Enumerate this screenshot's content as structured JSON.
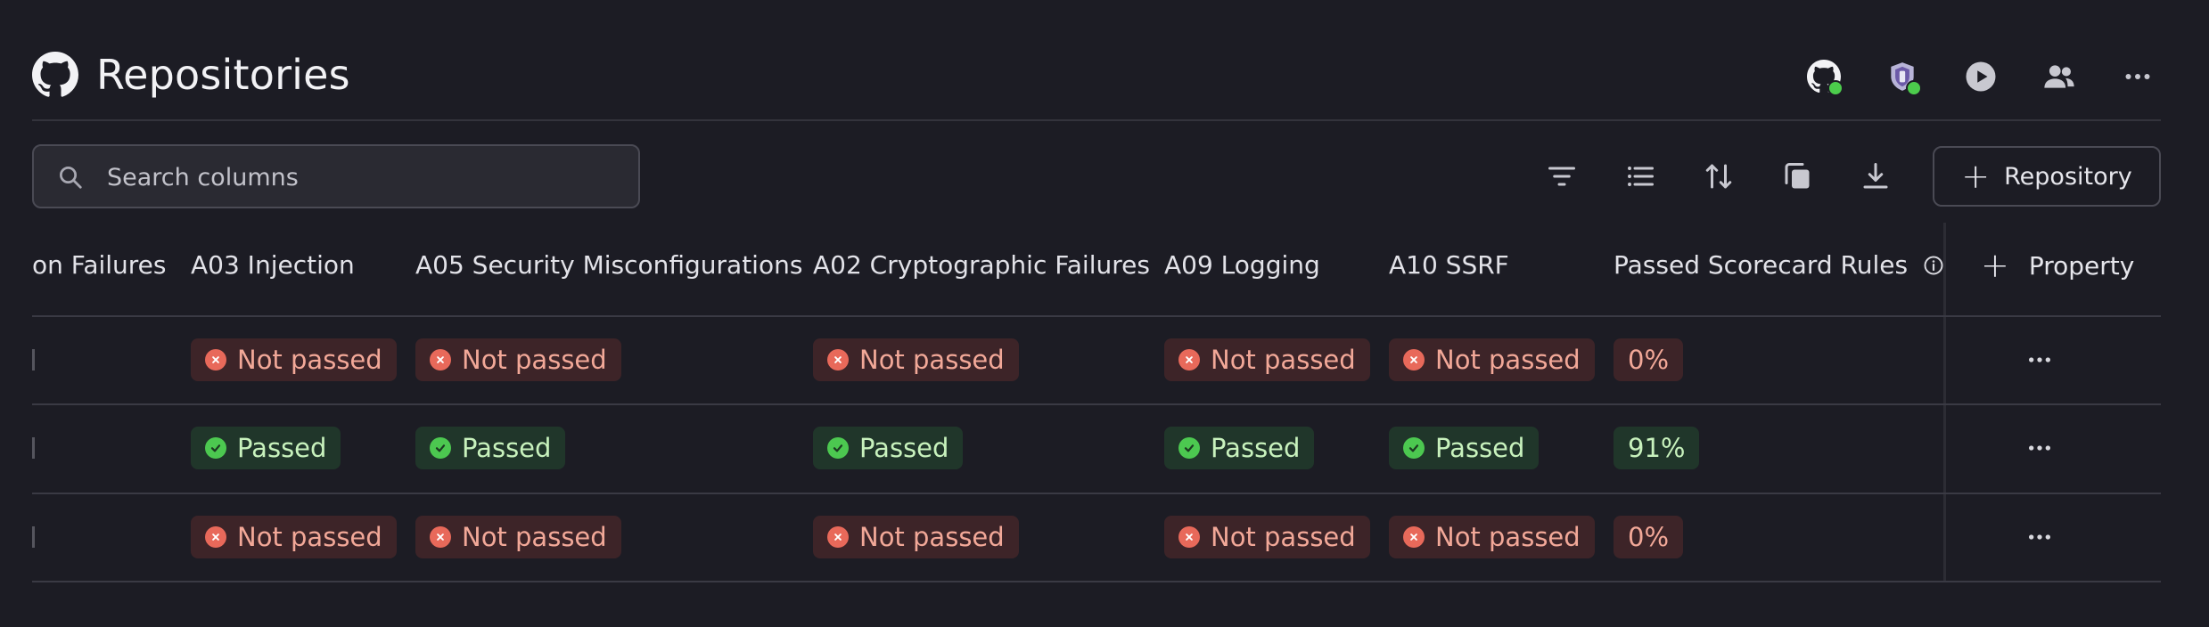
{
  "header": {
    "title": "Repositories",
    "title_icon": "github-icon",
    "actions": [
      {
        "name": "github-integration",
        "icon": "github-icon",
        "status": "connected"
      },
      {
        "name": "scorecard-integration",
        "icon": "badge-logo-icon",
        "status": "connected"
      },
      {
        "name": "run",
        "icon": "play-circle-icon"
      },
      {
        "name": "team",
        "icon": "users-icon"
      },
      {
        "name": "more",
        "icon": "more-horizontal-icon"
      }
    ]
  },
  "toolbar": {
    "search_placeholder": "Search columns",
    "tools": [
      "filter-icon",
      "list-icon",
      "sort-icon",
      "copy-icon",
      "download-icon"
    ],
    "add_button_label": "Repository"
  },
  "table": {
    "columns": [
      "on Failures",
      "A03 Injection",
      "A05 Security Misconfigurations",
      "A02 Cryptographic Failures",
      "A09 Logging",
      "A10 SSRF",
      "Passed Scorecard Rules"
    ],
    "add_property_label": "Property",
    "rows": [
      {
        "statuses": [
          "Not passed",
          "Not passed",
          "Not passed",
          "Not passed",
          "Not passed"
        ],
        "score": "0%",
        "state": "fail"
      },
      {
        "statuses": [
          "Passed",
          "Passed",
          "Passed",
          "Passed",
          "Passed"
        ],
        "score": "91%",
        "state": "pass"
      },
      {
        "statuses": [
          "Not passed",
          "Not passed",
          "Not passed",
          "Not passed",
          "Not passed"
        ],
        "score": "0%",
        "state": "fail"
      }
    ]
  },
  "colors": {
    "background": "#1c1c24",
    "fail_bg": "#3d2428",
    "fail_text": "#f2a898",
    "fail_icon": "#e8695a",
    "pass_bg": "#20362a",
    "pass_text": "#c8f2bd",
    "pass_icon": "#4cc850",
    "status_dot": "#4ccc4c"
  }
}
